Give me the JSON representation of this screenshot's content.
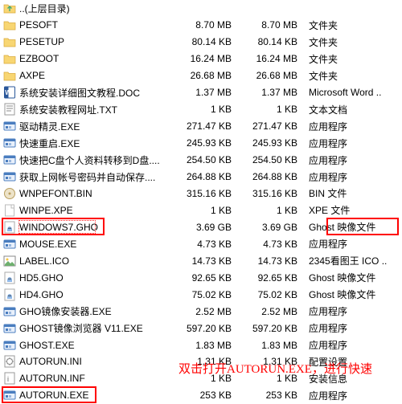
{
  "rows": [
    {
      "icon": "folder-up",
      "name": "..(上层目录)",
      "size": "",
      "size2": "",
      "type": ""
    },
    {
      "icon": "folder",
      "name": "PESOFT",
      "size": "8.70 MB",
      "size2": "8.70 MB",
      "type": "文件夹"
    },
    {
      "icon": "folder",
      "name": "PESETUP",
      "size": "80.14 KB",
      "size2": "80.14 KB",
      "type": "文件夹"
    },
    {
      "icon": "folder",
      "name": "EZBOOT",
      "size": "16.24 MB",
      "size2": "16.24 MB",
      "type": "文件夹"
    },
    {
      "icon": "folder",
      "name": "AXPE",
      "size": "26.68 MB",
      "size2": "26.68 MB",
      "type": "文件夹"
    },
    {
      "icon": "word",
      "name": "系统安装详细图文教程.DOC",
      "size": "1.37 MB",
      "size2": "1.37 MB",
      "type": "Microsoft Word .."
    },
    {
      "icon": "txt",
      "name": "系统安装教程网址.TXT",
      "size": "1 KB",
      "size2": "1 KB",
      "type": "文本文档"
    },
    {
      "icon": "exe",
      "name": "驱动精灵.EXE",
      "size": "271.47 KB",
      "size2": "271.47 KB",
      "type": "应用程序"
    },
    {
      "icon": "exe",
      "name": "快速重启.EXE",
      "size": "245.93 KB",
      "size2": "245.93 KB",
      "type": "应用程序"
    },
    {
      "icon": "exe",
      "name": "快速把C盘个人资料转移到D盘....",
      "size": "254.50 KB",
      "size2": "254.50 KB",
      "type": "应用程序"
    },
    {
      "icon": "exe",
      "name": "获取上网帐号密码并自动保存....",
      "size": "264.88 KB",
      "size2": "264.88 KB",
      "type": "应用程序"
    },
    {
      "icon": "bin",
      "name": "WNPEFONT.BIN",
      "size": "315.16 KB",
      "size2": "315.16 KB",
      "type": "BIN 文件"
    },
    {
      "icon": "blank",
      "name": "WINPE.XPE",
      "size": "1 KB",
      "size2": "1 KB",
      "type": "XPE 文件"
    },
    {
      "icon": "gho",
      "name": "WINDOWS7.GHO",
      "size": "3.69 GB",
      "size2": "3.69 GB",
      "type": "Ghost 映像文件"
    },
    {
      "icon": "exe",
      "name": "MOUSE.EXE",
      "size": "4.73 KB",
      "size2": "4.73 KB",
      "type": "应用程序"
    },
    {
      "icon": "ico",
      "name": "LABEL.ICO",
      "size": "14.73 KB",
      "size2": "14.73 KB",
      "type": "2345看图王 ICO .."
    },
    {
      "icon": "gho",
      "name": "HD5.GHO",
      "size": "92.65 KB",
      "size2": "92.65 KB",
      "type": "Ghost 映像文件"
    },
    {
      "icon": "gho",
      "name": "HD4.GHO",
      "size": "75.02 KB",
      "size2": "75.02 KB",
      "type": "Ghost 映像文件"
    },
    {
      "icon": "exe",
      "name": "GHO镜像安装器.EXE",
      "size": "2.52 MB",
      "size2": "2.52 MB",
      "type": "应用程序"
    },
    {
      "icon": "exe",
      "name": "GHOST镜像浏览器 V11.EXE",
      "size": "597.20 KB",
      "size2": "597.20 KB",
      "type": "应用程序"
    },
    {
      "icon": "exe",
      "name": "GHOST.EXE",
      "size": "1.83 MB",
      "size2": "1.83 MB",
      "type": "应用程序"
    },
    {
      "icon": "ini",
      "name": "AUTORUN.INI",
      "size": "1.31 KB",
      "size2": "1.31 KB",
      "type": "配置设置"
    },
    {
      "icon": "inf",
      "name": "AUTORUN.INF",
      "size": "1 KB",
      "size2": "1 KB",
      "type": "安装信息"
    },
    {
      "icon": "exe",
      "name": "AUTORUN.EXE",
      "size": "253 KB",
      "size2": "253 KB",
      "type": "应用程序"
    }
  ],
  "annotation": "双击打开AUTORUN.EXE，进行快速"
}
